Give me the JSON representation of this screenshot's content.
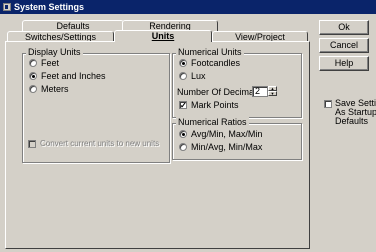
{
  "window": {
    "title": "System Settings"
  },
  "tabs": {
    "row1": [
      "Defaults",
      "Rendering"
    ],
    "row2": [
      "Switches/Settings",
      "Units",
      "View/Project"
    ],
    "active": "Units"
  },
  "display_units": {
    "title": "Display Units",
    "options": [
      "Feet",
      "Feet and Inches",
      "Meters"
    ],
    "selected": "Feet and Inches",
    "convert_label": "Convert current units to new units",
    "convert_checked": false,
    "convert_enabled": false
  },
  "numerical_units": {
    "title": "Numerical Units",
    "options": [
      "Footcandles",
      "Lux"
    ],
    "selected": "Footcandles",
    "decimals_label": "Number Of Decimals",
    "decimals_value": "2",
    "mark_points_label": "Mark Points",
    "mark_points_checked": true
  },
  "numerical_ratios": {
    "title": "Numerical Ratios",
    "options": [
      "Avg/Min, Max/Min",
      "Min/Avg, Min/Max"
    ],
    "selected": "Avg/Min, Max/Min"
  },
  "buttons": {
    "ok": "Ok",
    "cancel": "Cancel",
    "help": "Help"
  },
  "save_setting": {
    "label_line1": "Save Setting",
    "label_line2": "As Startup",
    "label_line3": "Defaults",
    "checked": false
  }
}
